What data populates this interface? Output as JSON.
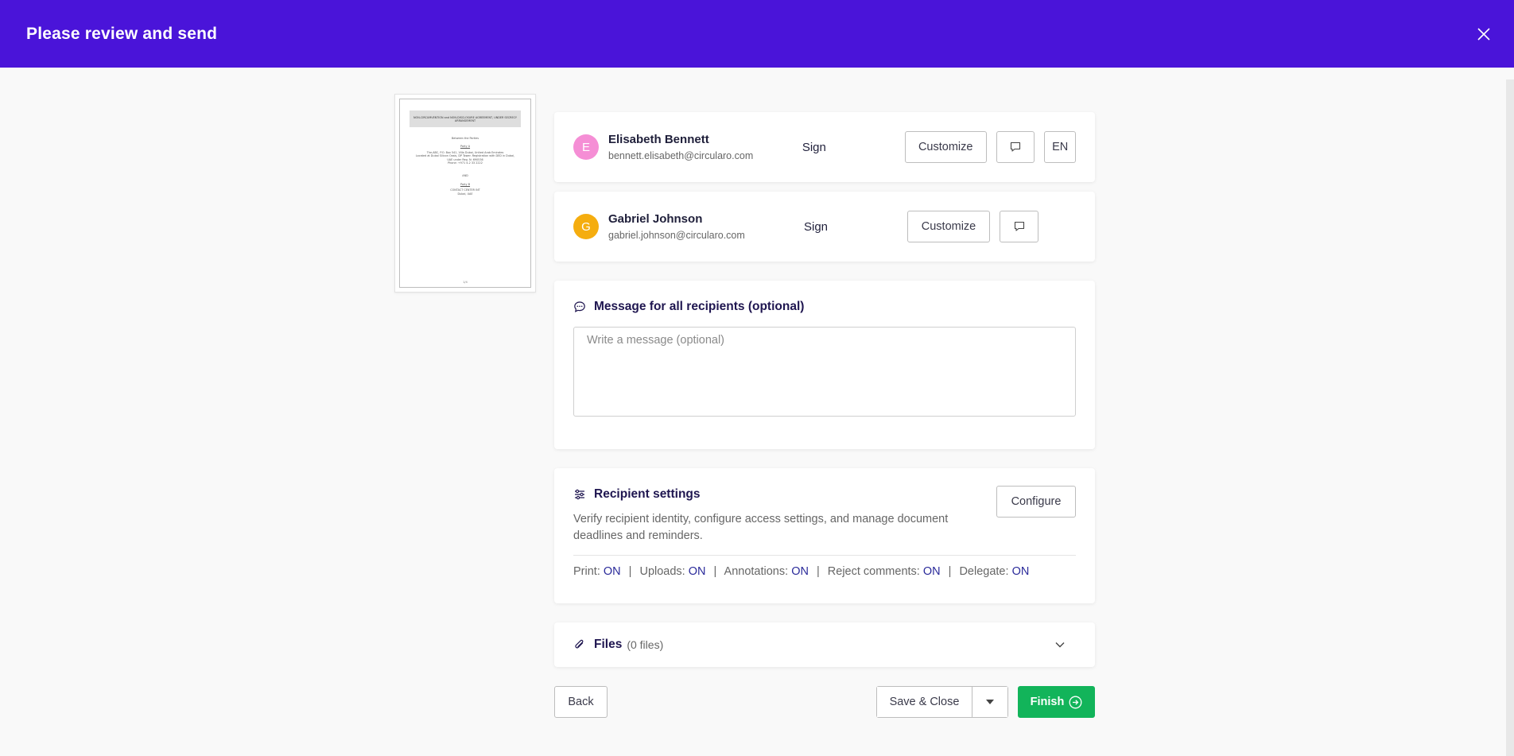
{
  "header": {
    "title": "Please review and send",
    "bg_color": "#4a14d9",
    "close_icon": "close-icon"
  },
  "document_preview": {
    "heading": "NON-CIRCUMVENTION and NON-DISCLOSURE AGREEMENT, UNDER SECRECY ARRANGEMENT",
    "between": "Between the Parties",
    "party_a_label": "Party A",
    "party_a_lines": [
      "The-ABC, P.O. Box 541, Villa Dubai, United Arab Emirates",
      "Located at Dubai Silicon Oasis, DP Tower. Registration with DED in Dubai,",
      "UAE under Reg. N: 690536",
      "Phone: +971 4-2 33 2222"
    ],
    "and": "AND",
    "party_b_label": "Party B",
    "party_b_lines": [
      "CONTACT CENTER INT",
      "Dubai, UAE"
    ],
    "page_number": "1/4"
  },
  "recipients": [
    {
      "initial": "E",
      "avatar_color": "#f58ed5",
      "name": "Elisabeth Bennett",
      "email": "bennett.elisabeth@circularo.com",
      "action": "Sign",
      "customize_label": "Customize",
      "comment_icon": "comment-icon",
      "language": "EN"
    },
    {
      "initial": "G",
      "avatar_color": "#f5ad0f",
      "name": "Gabriel Johnson",
      "email": "gabriel.johnson@circularo.com",
      "action": "Sign",
      "customize_label": "Customize",
      "comment_icon": "comment-icon"
    }
  ],
  "message": {
    "title": "Message for all recipients (optional)",
    "icon": "chat-bubble-icon",
    "placeholder": "Write a message (optional)",
    "value": ""
  },
  "settings": {
    "title": "Recipient settings",
    "icon": "sliders-icon",
    "description": "Verify recipient identity, configure access settings, and manage document deadlines and reminders.",
    "configure_label": "Configure",
    "items": [
      {
        "label": "Print:",
        "value": "ON"
      },
      {
        "label": "Uploads:",
        "value": "ON"
      },
      {
        "label": "Annotations:",
        "value": "ON"
      },
      {
        "label": "Reject comments:",
        "value": "ON"
      },
      {
        "label": "Delegate:",
        "value": "ON"
      }
    ],
    "separator": "|"
  },
  "files": {
    "title": "Files",
    "count": "(0 files)",
    "icon": "paperclip-icon",
    "expand_icon": "chevron-down-icon"
  },
  "footer": {
    "back_label": "Back",
    "save_close_label": "Save & Close",
    "save_menu_icon": "caret-down-icon",
    "finish_label": "Finish",
    "finish_icon": "arrow-circle-right-icon",
    "finish_color": "#12b45a"
  }
}
